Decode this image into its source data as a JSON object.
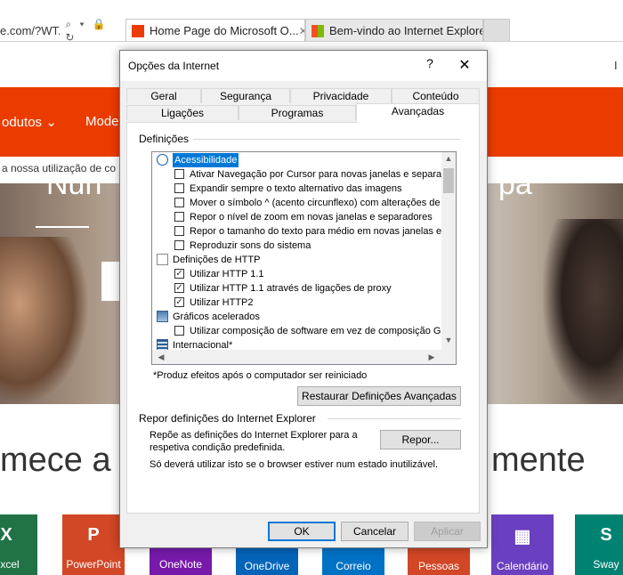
{
  "browser": {
    "address_text": "e.com/?WT.",
    "address_icons": "⌕ ▾ 🔒 ↻",
    "tabs": [
      {
        "label": "Home Page do Microsoft O...",
        "close": "✕",
        "icon_color": "#eb3c00"
      },
      {
        "label": "Bem-vindo ao Internet Explorer",
        "icon_color": "#0078d7"
      }
    ]
  },
  "page": {
    "top_right_text": "I",
    "nav": [
      "odutos ⌄",
      "Mode"
    ],
    "cookie_text": "a nossa utilização de co",
    "hero_left": "Nun",
    "hero_right": "pa",
    "headline_left": "mece a",
    "headline_right": "mente",
    "tiles": [
      {
        "label": "Excel",
        "icon": "X",
        "color": "#217346"
      },
      {
        "label": "PowerPoint",
        "icon": "P",
        "color": "#d24726"
      },
      {
        "label": "OneNote",
        "icon": "N",
        "color": "#7719aa"
      },
      {
        "label": "OneDrive",
        "icon": "☁",
        "color": "#0364b8"
      },
      {
        "label": "Correio",
        "icon": "✉",
        "color": "#0072c6"
      },
      {
        "label": "Pessoas",
        "icon": "👥",
        "color": "#d24726"
      },
      {
        "label": "Calendário",
        "icon": "▦",
        "color": "#6a3fc0"
      },
      {
        "label": "Sway",
        "icon": "S",
        "color": "#008272"
      }
    ]
  },
  "dialog": {
    "title": "Opções da Internet",
    "help": "?",
    "close": "✕",
    "tabs_row1": [
      "Geral",
      "Segurança",
      "Privacidade",
      "Conteúdo"
    ],
    "tabs_row2": [
      "Ligações",
      "Programas",
      "Avançadas"
    ],
    "settings_label": "Definições",
    "items": [
      {
        "type": "category",
        "text": "Acessibilidade",
        "icon": "accessibility-icon",
        "selected": true
      },
      {
        "type": "checkbox",
        "text": "Ativar Navegação por Cursor para novas janelas e separa",
        "checked": false
      },
      {
        "type": "checkbox",
        "text": "Expandir sempre o texto alternativo das imagens",
        "checked": false
      },
      {
        "type": "checkbox",
        "text": "Mover o símbolo ^ (acento circunflexo) com alterações de",
        "checked": false
      },
      {
        "type": "checkbox",
        "text": "Repor o nível de zoom em novas janelas e separadores",
        "checked": false
      },
      {
        "type": "checkbox",
        "text": "Repor o tamanho do texto para médio em novas janelas e",
        "checked": false
      },
      {
        "type": "checkbox",
        "text": "Reproduzir sons do sistema",
        "checked": false
      },
      {
        "type": "category",
        "text": "Definições de HTTP",
        "icon": "document-icon",
        "selected": false
      },
      {
        "type": "checkbox",
        "text": "Utilizar HTTP 1.1",
        "checked": true
      },
      {
        "type": "checkbox",
        "text": "Utilizar HTTP 1.1 através de ligações de proxy",
        "checked": true
      },
      {
        "type": "checkbox",
        "text": "Utilizar HTTP2",
        "checked": true
      },
      {
        "type": "category",
        "text": "Gráficos acelerados",
        "icon": "monitor-icon",
        "selected": false
      },
      {
        "type": "checkbox",
        "text": "Utilizar composição de software em vez de composição GP",
        "checked": false
      },
      {
        "type": "category",
        "text": "Internacional*",
        "icon": "globe-icon",
        "selected": false
      }
    ],
    "restart_note": "*Produz efeitos após o computador ser reiniciado",
    "restore_button": "Restaurar Definições Avançadas",
    "reset_section_label": "Repor definições do Internet Explorer",
    "reset_desc": "Repõe as definições do Internet Explorer para a respetiva condição predefinida.",
    "reset_button": "Repor...",
    "reset_warning": "Só deverá utilizar isto se o browser estiver num estado inutilizável.",
    "ok": "OK",
    "cancel": "Cancelar",
    "apply": "Aplicar"
  }
}
